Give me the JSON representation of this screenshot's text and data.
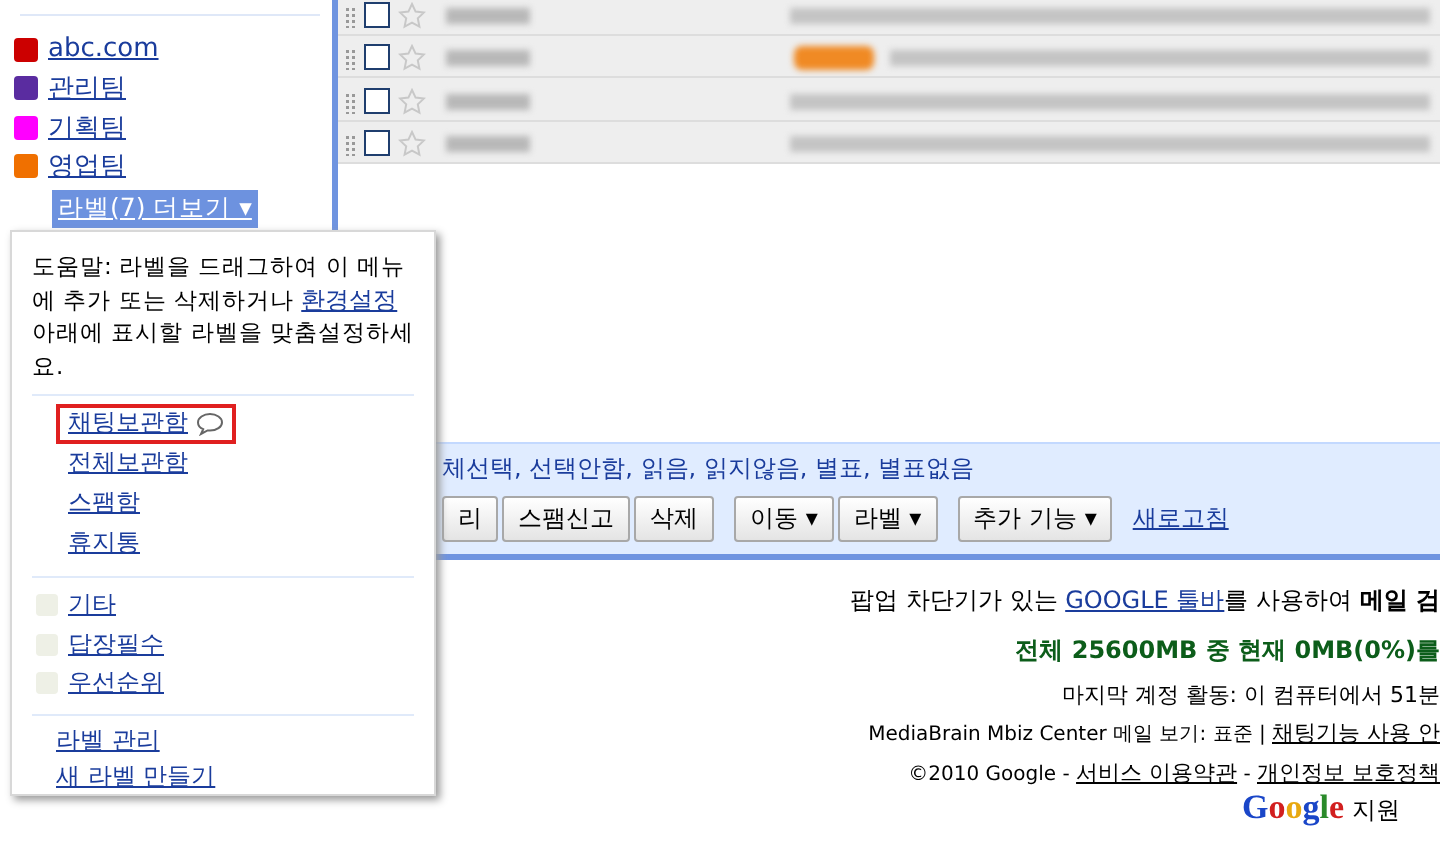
{
  "sidebar": {
    "labels": [
      {
        "name": "abc.com",
        "color": "#cc0000"
      },
      {
        "name": "관리팀",
        "color": "#5a2ca0"
      },
      {
        "name": "기획팀",
        "color": "#ff00ff"
      },
      {
        "name": "영업팀",
        "color": "#f07000"
      }
    ],
    "more_button": "라벨(7) 더보기 ▾"
  },
  "email_rows": [
    {
      "checked": false,
      "starred": false,
      "tagged": false
    },
    {
      "checked": false,
      "starred": false,
      "tagged": true
    },
    {
      "checked": false,
      "starred": false,
      "tagged": false
    },
    {
      "checked": false,
      "starred": false,
      "tagged": false
    }
  ],
  "popup": {
    "help_before": "도움말: 라벨을 드래그하여 이 메뉴에 추가 또는 삭제하거나 ",
    "help_link": "환경설정",
    "help_after": " 아래에 표시할 라벨을 맞춤설정하세요.",
    "system_items": [
      {
        "label": "채팅보관함",
        "highlighted": true,
        "kind": "chat"
      },
      {
        "label": "전체보관함",
        "highlighted": false,
        "kind": "plain"
      },
      {
        "label": "스팸함",
        "highlighted": false,
        "kind": "plain"
      },
      {
        "label": "휴지통",
        "highlighted": false,
        "kind": "plain"
      }
    ],
    "label_items": [
      {
        "label": "기타",
        "color": "#eef0e6"
      },
      {
        "label": "답장필수",
        "color": "#eef0e6"
      },
      {
        "label": "우선순위",
        "color": "#eef0e6"
      }
    ],
    "footer_links": [
      "라벨 관리",
      "새 라벨 만들기"
    ]
  },
  "toolbar": {
    "select_text": "체선택, 선택안함, 읽음, 읽지않음, 별표, 별표없음",
    "button_groups": [
      [
        "리",
        "스팸신고",
        "삭제"
      ],
      [
        "이동 ▾",
        "라벨 ▾"
      ],
      [
        "추가 기능 ▾"
      ]
    ],
    "refresh_link": "새로고침"
  },
  "footer": {
    "toolbar_before": "팝업 차단기가 있는 ",
    "toolbar_link": "GOOGLE 툴바",
    "toolbar_after": "를 사용하여 **메일 검**",
    "storage": "전체 25600MB 중 현재 0MB(0%)를",
    "last_activity": "마지막 계정 활동: 이 컴퓨터에서 51분",
    "view_before": "MediaBrain Mbiz Center 메일 보기: 표준 | ",
    "view_link": "채팅기능 사용 안",
    "copyright": "©2010 Google - ",
    "terms_link": "서비스 이용약관",
    "separator": " - ",
    "privacy_link": "개인정보 보호정책",
    "logo_letters": [
      {
        "letter": "G",
        "color": "#1a46c8"
      },
      {
        "letter": "o",
        "color": "#d21f1f"
      },
      {
        "letter": "o",
        "color": "#e8a810"
      },
      {
        "letter": "g",
        "color": "#1a46c8"
      },
      {
        "letter": "l",
        "color": "#2a8a2a"
      },
      {
        "letter": "e",
        "color": "#d21f1f"
      }
    ],
    "support": "지원"
  }
}
